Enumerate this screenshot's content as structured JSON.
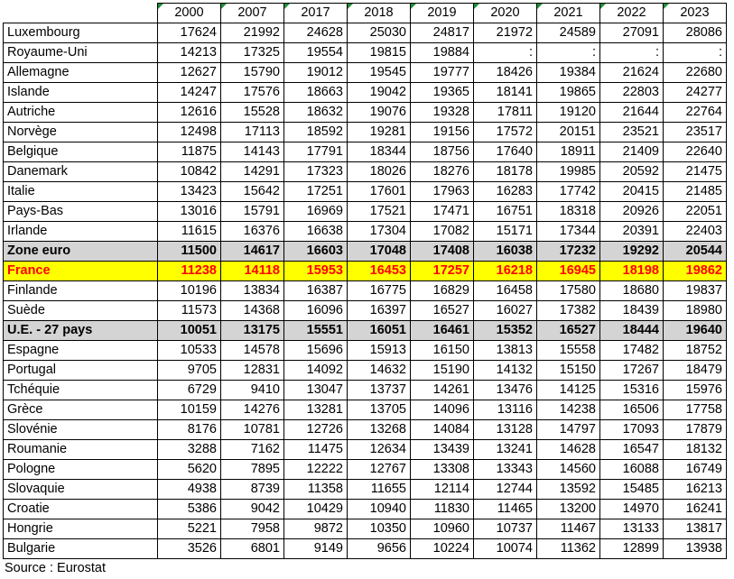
{
  "years": [
    "2000",
    "2007",
    "2017",
    "2018",
    "2019",
    "2020",
    "2021",
    "2022",
    "2023"
  ],
  "rows": [
    {
      "label": "Luxembourg",
      "values": [
        "17624",
        "21992",
        "24628",
        "25030",
        "24817",
        "21972",
        "24589",
        "27091",
        "28086"
      ],
      "style": ""
    },
    {
      "label": "Royaume-Uni",
      "values": [
        "14213",
        "17325",
        "19554",
        "19815",
        "19884",
        ":",
        ":",
        ":",
        ":"
      ],
      "style": ""
    },
    {
      "label": "Allemagne",
      "values": [
        "12627",
        "15790",
        "19012",
        "19545",
        "19777",
        "18426",
        "19384",
        "21624",
        "22680"
      ],
      "style": ""
    },
    {
      "label": "Islande",
      "values": [
        "14247",
        "17576",
        "18663",
        "19042",
        "19365",
        "18141",
        "19865",
        "22803",
        "24277"
      ],
      "style": ""
    },
    {
      "label": "Autriche",
      "values": [
        "12616",
        "15528",
        "18632",
        "19076",
        "19328",
        "17811",
        "19120",
        "21644",
        "22764"
      ],
      "style": ""
    },
    {
      "label": "Norvège",
      "values": [
        "12498",
        "17113",
        "18592",
        "19281",
        "19156",
        "17572",
        "20151",
        "23521",
        "23517"
      ],
      "style": ""
    },
    {
      "label": "Belgique",
      "values": [
        "11875",
        "14143",
        "17791",
        "18344",
        "18756",
        "17640",
        "18911",
        "21409",
        "22640"
      ],
      "style": ""
    },
    {
      "label": "Danemark",
      "values": [
        "10842",
        "14291",
        "17323",
        "18026",
        "18276",
        "18178",
        "19985",
        "20592",
        "21475"
      ],
      "style": ""
    },
    {
      "label": "Italie",
      "values": [
        "13423",
        "15642",
        "17251",
        "17601",
        "17963",
        "16283",
        "17742",
        "20415",
        "21485"
      ],
      "style": ""
    },
    {
      "label": "Pays-Bas",
      "values": [
        "13016",
        "15791",
        "16969",
        "17521",
        "17471",
        "16751",
        "18318",
        "20926",
        "22051"
      ],
      "style": ""
    },
    {
      "label": "Irlande",
      "values": [
        "11615",
        "16376",
        "16638",
        "17304",
        "17082",
        "15171",
        "17344",
        "20391",
        "22403"
      ],
      "style": ""
    },
    {
      "label": "Zone euro",
      "values": [
        "11500",
        "14617",
        "16603",
        "17048",
        "17408",
        "16038",
        "17232",
        "19292",
        "20544"
      ],
      "style": "zone"
    },
    {
      "label": "France",
      "values": [
        "11238",
        "14118",
        "15953",
        "16453",
        "17257",
        "16218",
        "16945",
        "18198",
        "19862"
      ],
      "style": "hl"
    },
    {
      "label": "Finlande",
      "values": [
        "10196",
        "13834",
        "16387",
        "16775",
        "16829",
        "16458",
        "17580",
        "18680",
        "19837"
      ],
      "style": ""
    },
    {
      "label": "Suède",
      "values": [
        "11573",
        "14368",
        "16096",
        "16397",
        "16527",
        "16027",
        "17382",
        "18439",
        "18980"
      ],
      "style": ""
    },
    {
      "label": "U.E. - 27 pays",
      "values": [
        "10051",
        "13175",
        "15551",
        "16051",
        "16461",
        "15352",
        "16527",
        "18444",
        "19640"
      ],
      "style": "zone"
    },
    {
      "label": "Espagne",
      "values": [
        "10533",
        "14578",
        "15696",
        "15913",
        "16150",
        "13813",
        "15558",
        "17482",
        "18752"
      ],
      "style": ""
    },
    {
      "label": "Portugal",
      "values": [
        "9705",
        "12831",
        "14092",
        "14632",
        "15190",
        "14132",
        "15150",
        "17267",
        "18479"
      ],
      "style": ""
    },
    {
      "label": "Tchéquie",
      "values": [
        "6729",
        "9410",
        "13047",
        "13737",
        "14261",
        "13476",
        "14125",
        "15316",
        "15976"
      ],
      "style": ""
    },
    {
      "label": "Grèce",
      "values": [
        "10159",
        "14276",
        "13281",
        "13705",
        "14096",
        "13116",
        "14238",
        "16506",
        "17758"
      ],
      "style": ""
    },
    {
      "label": "Slovénie",
      "values": [
        "8176",
        "10781",
        "12726",
        "13268",
        "14084",
        "13128",
        "14797",
        "17093",
        "17879"
      ],
      "style": ""
    },
    {
      "label": "Roumanie",
      "values": [
        "3288",
        "7162",
        "11475",
        "12634",
        "13439",
        "13241",
        "14628",
        "16547",
        "18132"
      ],
      "style": ""
    },
    {
      "label": "Pologne",
      "values": [
        "5620",
        "7895",
        "12222",
        "12767",
        "13308",
        "13343",
        "14560",
        "16088",
        "16749"
      ],
      "style": ""
    },
    {
      "label": "Slovaquie",
      "values": [
        "4938",
        "8739",
        "11358",
        "11655",
        "12114",
        "12744",
        "13592",
        "15485",
        "16213"
      ],
      "style": ""
    },
    {
      "label": "Croatie",
      "values": [
        "5386",
        "9042",
        "10429",
        "10940",
        "11830",
        "11465",
        "13200",
        "14970",
        "16241"
      ],
      "style": ""
    },
    {
      "label": "Hongrie",
      "values": [
        "5221",
        "7958",
        "9872",
        "10350",
        "10960",
        "10737",
        "11467",
        "13133",
        "13817"
      ],
      "style": ""
    },
    {
      "label": "Bulgarie",
      "values": [
        "3526",
        "6801",
        "9149",
        "9656",
        "10224",
        "10074",
        "11362",
        "12899",
        "13938"
      ],
      "style": ""
    }
  ],
  "source": "Source : Eurostat",
  "colors": {
    "zone_row_bg": "#d4d4d4",
    "highlight_bg": "#ffff00",
    "highlight_text": "#ff0000",
    "cell_marker": "#1e8f3a"
  }
}
